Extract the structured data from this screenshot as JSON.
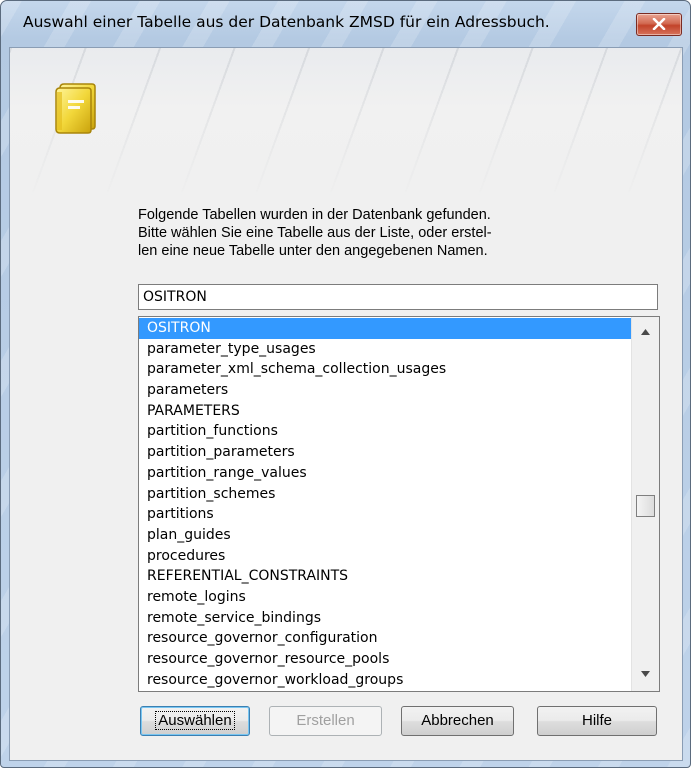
{
  "window": {
    "title": "Auswahl einer Tabelle aus der Datenbank ZMSD für ein Adressbuch."
  },
  "icons": {
    "close": "close-icon",
    "app": "address-book-icon",
    "scroll_up": "scroll-up-arrow-icon",
    "scroll_down": "scroll-down-arrow-icon"
  },
  "intro": {
    "line1": "Folgende Tabellen wurden in der Datenbank gefunden.",
    "line2": "Bitte wählen Sie eine Tabelle aus der Liste, oder erstel-",
    "line3": "len eine neue Tabelle unter den angegebenen Namen."
  },
  "name_input": {
    "value": "OSITRON"
  },
  "table_list": {
    "selected_index": 0,
    "items": [
      "OSITRON",
      "parameter_type_usages",
      "parameter_xml_schema_collection_usages",
      "parameters",
      "PARAMETERS",
      "partition_functions",
      "partition_parameters",
      "partition_range_values",
      "partition_schemes",
      "partitions",
      "plan_guides",
      "procedures",
      "REFERENTIAL_CONSTRAINTS",
      "remote_logins",
      "remote_service_bindings",
      "resource_governor_configuration",
      "resource_governor_resource_pools",
      "resource_governor_workload_groups"
    ]
  },
  "buttons": {
    "select": "Auswählen",
    "create": "Erstellen",
    "cancel": "Abbrechen",
    "help": "Hilfe"
  },
  "colors": {
    "selection": "#3399ff",
    "close_button": "#c2432a"
  }
}
